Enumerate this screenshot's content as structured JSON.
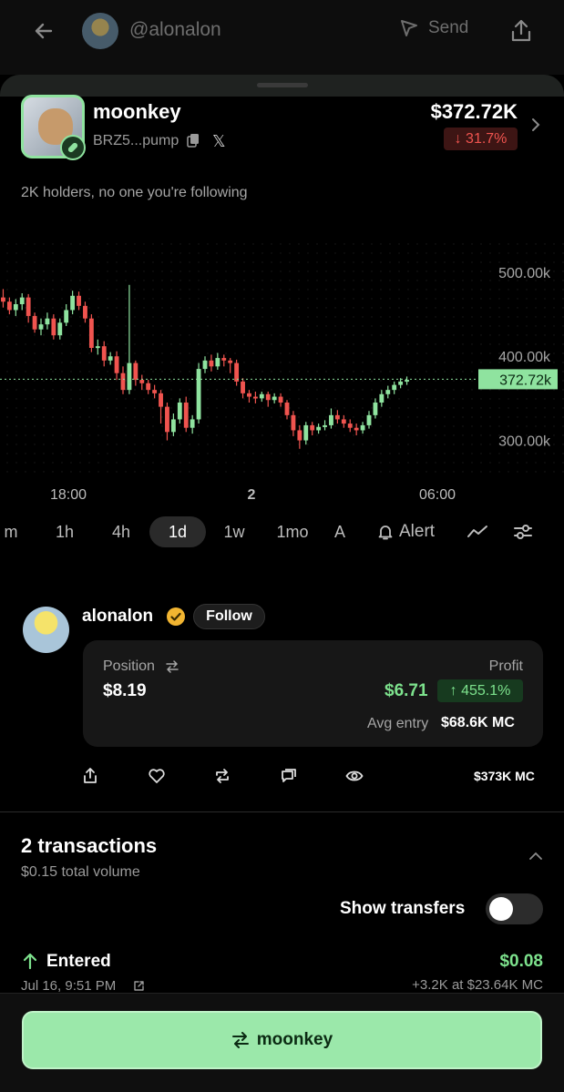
{
  "header": {
    "handle": "@alonalon",
    "send_label": "Send"
  },
  "token": {
    "name": "moonkey",
    "address": "BRZ5...pump",
    "market_cap": "$372.72K",
    "change": "↓ 31.7%",
    "holders_text": "2K holders, no one you're following"
  },
  "chart_data": {
    "type": "candlestick",
    "x_tick_labels": [
      "18:00",
      "2",
      "06:00"
    ],
    "y_tick_labels": [
      "500.00k",
      "400.00k",
      "300.00k"
    ],
    "current_price_label": "372.72k",
    "current_value": 372720,
    "ylim": [
      280000,
      540000
    ],
    "colors": {
      "up": "#8fe39f",
      "down": "#f0544f"
    },
    "candles": [
      [
        470,
        465,
        480,
        458
      ],
      [
        465,
        455,
        470,
        450
      ],
      [
        455,
        462,
        468,
        448
      ],
      [
        462,
        470,
        475,
        455
      ],
      [
        470,
        448,
        474,
        440
      ],
      [
        448,
        432,
        452,
        428
      ],
      [
        432,
        438,
        445,
        425
      ],
      [
        438,
        445,
        452,
        432
      ],
      [
        445,
        425,
        450,
        420
      ],
      [
        425,
        440,
        445,
        420
      ],
      [
        440,
        455,
        462,
        436
      ],
      [
        455,
        472,
        478,
        450
      ],
      [
        472,
        460,
        477,
        455
      ],
      [
        460,
        445,
        465,
        440
      ],
      [
        445,
        410,
        450,
        405
      ],
      [
        410,
        412,
        420,
        402
      ],
      [
        412,
        395,
        418,
        388
      ],
      [
        395,
        400,
        405,
        390
      ],
      [
        400,
        380,
        406,
        372
      ],
      [
        380,
        360,
        388,
        355
      ],
      [
        360,
        392,
        485,
        355
      ],
      [
        392,
        372,
        395,
        365
      ],
      [
        372,
        368,
        378,
        360
      ],
      [
        368,
        360,
        372,
        355
      ],
      [
        360,
        356,
        366,
        350
      ],
      [
        356,
        340,
        360,
        320
      ],
      [
        340,
        310,
        345,
        300
      ],
      [
        310,
        325,
        332,
        305
      ],
      [
        325,
        345,
        350,
        320
      ],
      [
        345,
        315,
        352,
        310
      ],
      [
        315,
        325,
        330,
        308
      ],
      [
        325,
        385,
        392,
        320
      ],
      [
        385,
        395,
        400,
        380
      ],
      [
        395,
        388,
        402,
        382
      ],
      [
        388,
        398,
        404,
        384
      ],
      [
        398,
        395,
        402,
        388
      ],
      [
        395,
        392,
        398,
        380
      ],
      [
        392,
        370,
        396,
        365
      ],
      [
        370,
        356,
        374,
        350
      ],
      [
        356,
        352,
        360,
        345
      ],
      [
        352,
        350,
        358,
        344
      ],
      [
        350,
        355,
        358,
        346
      ],
      [
        355,
        348,
        358,
        340
      ],
      [
        348,
        352,
        356,
        344
      ],
      [
        352,
        345,
        356,
        340
      ],
      [
        345,
        330,
        348,
        325
      ],
      [
        330,
        312,
        335,
        305
      ],
      [
        312,
        300,
        318,
        290
      ],
      [
        300,
        318,
        322,
        295
      ],
      [
        318,
        312,
        322,
        306
      ],
      [
        312,
        316,
        320,
        308
      ],
      [
        316,
        318,
        324,
        312
      ],
      [
        318,
        330,
        338,
        314
      ],
      [
        330,
        325,
        336,
        320
      ],
      [
        325,
        320,
        330,
        315
      ],
      [
        320,
        315,
        325,
        310
      ],
      [
        315,
        312,
        320,
        306
      ],
      [
        312,
        318,
        322,
        308
      ],
      [
        318,
        330,
        335,
        314
      ],
      [
        330,
        345,
        350,
        326
      ],
      [
        345,
        355,
        360,
        340
      ],
      [
        355,
        360,
        365,
        350
      ],
      [
        360,
        366,
        370,
        355
      ],
      [
        366,
        370,
        374,
        362
      ],
      [
        370,
        372,
        376,
        366
      ]
    ]
  },
  "timeframes": [
    "m",
    "1h",
    "4h",
    "1d",
    "1w",
    "1mo",
    "A"
  ],
  "timeframe_active": "1d",
  "alert_label": "Alert",
  "trader": {
    "name": "alonalon",
    "follow_label": "Follow",
    "position_label": "Position",
    "position_value": "$8.19",
    "profit_label": "Profit",
    "profit_value": "$6.71",
    "profit_change": "↑ 455.1%",
    "avg_entry_label": "Avg entry",
    "avg_entry_value": "$68.6K MC",
    "mc_label": "$373K  MC"
  },
  "transactions": {
    "title": "2 transactions",
    "volume": "$0.15 total volume",
    "show_transfers_label": "Show transfers",
    "show_transfers_on": false,
    "items": [
      {
        "type": "Entered",
        "amount": "$0.08",
        "date": "Jul 16, 9:51 PM",
        "detail": "+3.2K at $23.64K MC"
      }
    ]
  },
  "bottom": {
    "swap_label": "moonkey"
  }
}
